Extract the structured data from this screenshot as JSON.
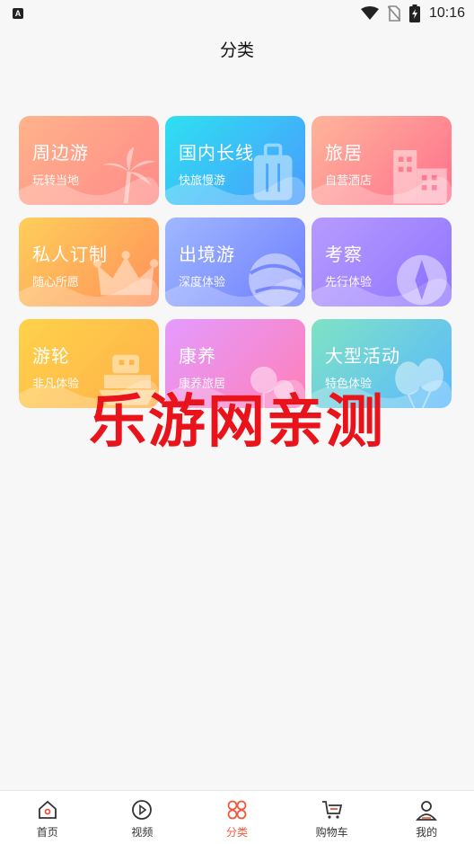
{
  "status_bar": {
    "time": "10:16",
    "app_badge": "A"
  },
  "header": {
    "title": "分类"
  },
  "categories": [
    {
      "title": "周边游",
      "subtitle": "玩转当地",
      "icon": "palm-tree-icon",
      "gradient": [
        "#ffb38a",
        "#ff8a8a"
      ]
    },
    {
      "title": "国内长线",
      "subtitle": "快旅慢游",
      "icon": "suitcase-icon",
      "gradient": [
        "#2ee0f0",
        "#4a9bff"
      ]
    },
    {
      "title": "旅居",
      "subtitle": "自营酒店",
      "icon": "building-icon",
      "gradient": [
        "#ffb59a",
        "#ff6f8e"
      ]
    },
    {
      "title": "私人订制",
      "subtitle": "随心所愿",
      "icon": "crown-icon",
      "gradient": [
        "#ffcf5a",
        "#ff8f5a"
      ]
    },
    {
      "title": "出境游",
      "subtitle": "深度体验",
      "icon": "globe-icon",
      "gradient": [
        "#9fb8ff",
        "#6e7dff"
      ]
    },
    {
      "title": "考察",
      "subtitle": "先行体验",
      "icon": "compass-icon",
      "gradient": [
        "#b79bff",
        "#8f74ff"
      ]
    },
    {
      "title": "游轮",
      "subtitle": "非凡体验",
      "icon": "ship-icon",
      "gradient": [
        "#ffd24a",
        "#ffb04a"
      ]
    },
    {
      "title": "康养",
      "subtitle": "康养旅居",
      "icon": "balloon-icon",
      "gradient": [
        "#e49bff",
        "#ff7fb8"
      ]
    },
    {
      "title": "大型活动",
      "subtitle": "特色体验",
      "icon": "balloons-icon",
      "gradient": [
        "#7fe3c4",
        "#5ab8ff"
      ]
    }
  ],
  "watermark": "乐游网亲测",
  "tabbar": {
    "items": [
      {
        "label": "首页",
        "icon": "home-icon"
      },
      {
        "label": "视频",
        "icon": "video-icon"
      },
      {
        "label": "分类",
        "icon": "category-icon",
        "active": true
      },
      {
        "label": "购物车",
        "icon": "cart-icon"
      },
      {
        "label": "我的",
        "icon": "user-icon"
      }
    ],
    "active_color": "#f05a3c"
  }
}
